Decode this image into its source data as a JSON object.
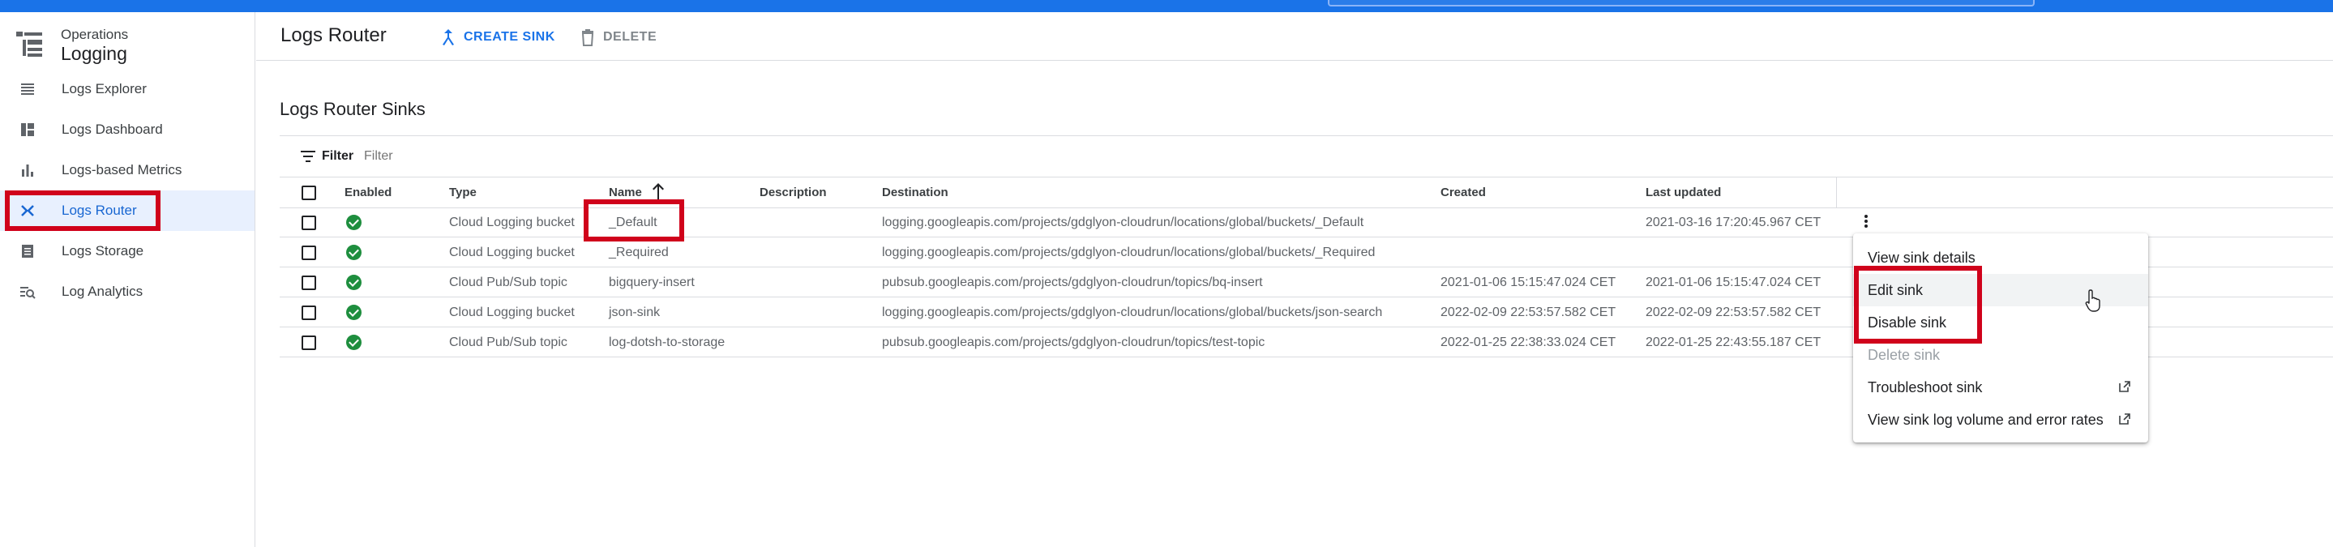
{
  "brand": {
    "sub": "Operations",
    "title": "Logging"
  },
  "sidebar": {
    "items": [
      {
        "label": "Logs Explorer",
        "icon": "list-icon"
      },
      {
        "label": "Logs Dashboard",
        "icon": "dashboard-icon"
      },
      {
        "label": "Logs-based Metrics",
        "icon": "bar-chart-icon"
      },
      {
        "label": "Logs Router",
        "icon": "router-icon",
        "active": true
      },
      {
        "label": "Logs Storage",
        "icon": "storage-icon"
      },
      {
        "label": "Log Analytics",
        "icon": "analytics-icon"
      }
    ]
  },
  "header": {
    "title": "Logs Router",
    "create_label": "CREATE SINK",
    "delete_label": "DELETE"
  },
  "section_title": "Logs Router Sinks",
  "filter": {
    "label": "Filter",
    "placeholder": "Filter"
  },
  "table": {
    "headers": {
      "enabled": "Enabled",
      "type": "Type",
      "name": "Name",
      "description": "Description",
      "destination": "Destination",
      "created": "Created",
      "last_updated": "Last updated"
    },
    "rows": [
      {
        "type": "Cloud Logging bucket",
        "name": "_Default",
        "description": "",
        "destination": "logging.googleapis.com/projects/gdglyon-cloudrun/locations/global/buckets/_Default",
        "created": "",
        "last_updated": "2021-03-16 17:20:45.967 CET"
      },
      {
        "type": "Cloud Logging bucket",
        "name": "_Required",
        "description": "",
        "destination": "logging.googleapis.com/projects/gdglyon-cloudrun/locations/global/buckets/_Required",
        "created": "",
        "last_updated": ""
      },
      {
        "type": "Cloud Pub/Sub topic",
        "name": "bigquery-insert",
        "description": "",
        "destination": "pubsub.googleapis.com/projects/gdglyon-cloudrun/topics/bq-insert",
        "created": "2021-01-06 15:15:47.024 CET",
        "last_updated": "2021-01-06 15:15:47.024 CET"
      },
      {
        "type": "Cloud Logging bucket",
        "name": "json-sink",
        "description": "",
        "destination": "logging.googleapis.com/projects/gdglyon-cloudrun/locations/global/buckets/json-search",
        "created": "2022-02-09 22:53:57.582 CET",
        "last_updated": "2022-02-09 22:53:57.582 CET"
      },
      {
        "type": "Cloud Pub/Sub topic",
        "name": "log-dotsh-to-storage",
        "description": "",
        "destination": "pubsub.googleapis.com/projects/gdglyon-cloudrun/topics/test-topic",
        "created": "2022-01-25 22:38:33.024 CET",
        "last_updated": "2022-01-25 22:43:55.187 CET"
      }
    ]
  },
  "menu": {
    "items": [
      {
        "label": "View sink details"
      },
      {
        "label": "Edit sink"
      },
      {
        "label": "Disable sink"
      },
      {
        "label": "Delete sink",
        "disabled": true
      },
      {
        "label": "Troubleshoot sink",
        "external": true
      },
      {
        "label": "View sink log volume and error rates",
        "external": true
      }
    ]
  },
  "colors": {
    "accent": "#1a73e8",
    "highlight": "#d0021b",
    "success": "#1e8e3e"
  }
}
